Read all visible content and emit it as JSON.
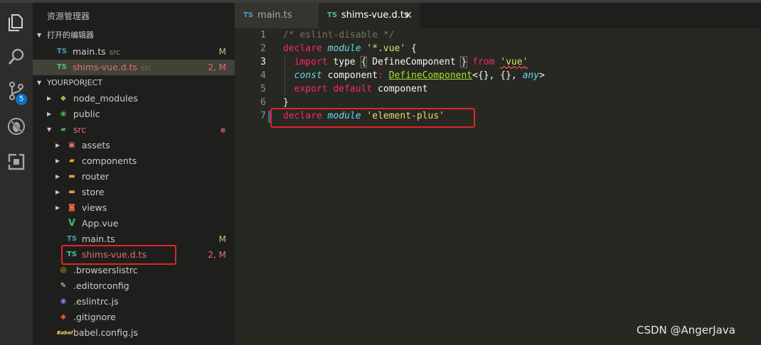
{
  "explorer": {
    "title": "资源管理器",
    "open_editors_header": "打开的编辑器",
    "project_header": "YOURPORJECT",
    "open_editors": [
      {
        "icon": "TS",
        "name": "main.ts",
        "path": "src",
        "status": "M"
      },
      {
        "icon": "TS",
        "name": "shims-vue.d.ts",
        "path": "src",
        "status": "2, M"
      }
    ],
    "tree": [
      {
        "name": "node_modules"
      },
      {
        "name": "public"
      },
      {
        "name": "src"
      },
      {
        "name": "assets"
      },
      {
        "name": "components"
      },
      {
        "name": "router"
      },
      {
        "name": "store"
      },
      {
        "name": "views"
      },
      {
        "name": "App.vue"
      },
      {
        "name": "main.ts",
        "status": "M"
      },
      {
        "name": "shims-vue.d.ts",
        "status": "2, M"
      },
      {
        "name": ".browserslistrc"
      },
      {
        "name": ".editorconfig"
      },
      {
        "name": ".eslintrc.js"
      },
      {
        "name": ".gitignore"
      },
      {
        "name": "babel.config.js"
      }
    ]
  },
  "activity": {
    "scm_badge": "5"
  },
  "tabs": [
    {
      "icon": "TS",
      "label": "main.ts"
    },
    {
      "icon": "TS",
      "label": "shims-vue.d.ts",
      "close": "✕"
    }
  ],
  "editor": {
    "line_numbers": [
      "1",
      "2",
      "3",
      "4",
      "5",
      "6",
      "7"
    ],
    "tokens": {
      "l1": "/* eslint-disable */",
      "declare": "declare",
      "module": "module",
      "vue_str": "'*.vue'",
      "lbrace": "{",
      "import": "import",
      "type": "type",
      "lb": "{",
      "define1": "DefineComponent",
      "rb": "}",
      "from": "from",
      "vue": "'vue'",
      "const": "const",
      "component": "component",
      "colon": ":",
      "define2": "DefineComponent",
      "generic": "<{}, {}, ",
      "any": "any",
      "gt": ">",
      "export": "export",
      "default": "default",
      "component2": "component",
      "rbrace": "}",
      "declare2": "declare",
      "module2": "module",
      "ep_str": "'element-plus'"
    }
  },
  "watermark": "CSDN @AngerJava",
  "colors": {
    "highlight_box": "#e0242b",
    "badge": "#0e73c7"
  }
}
